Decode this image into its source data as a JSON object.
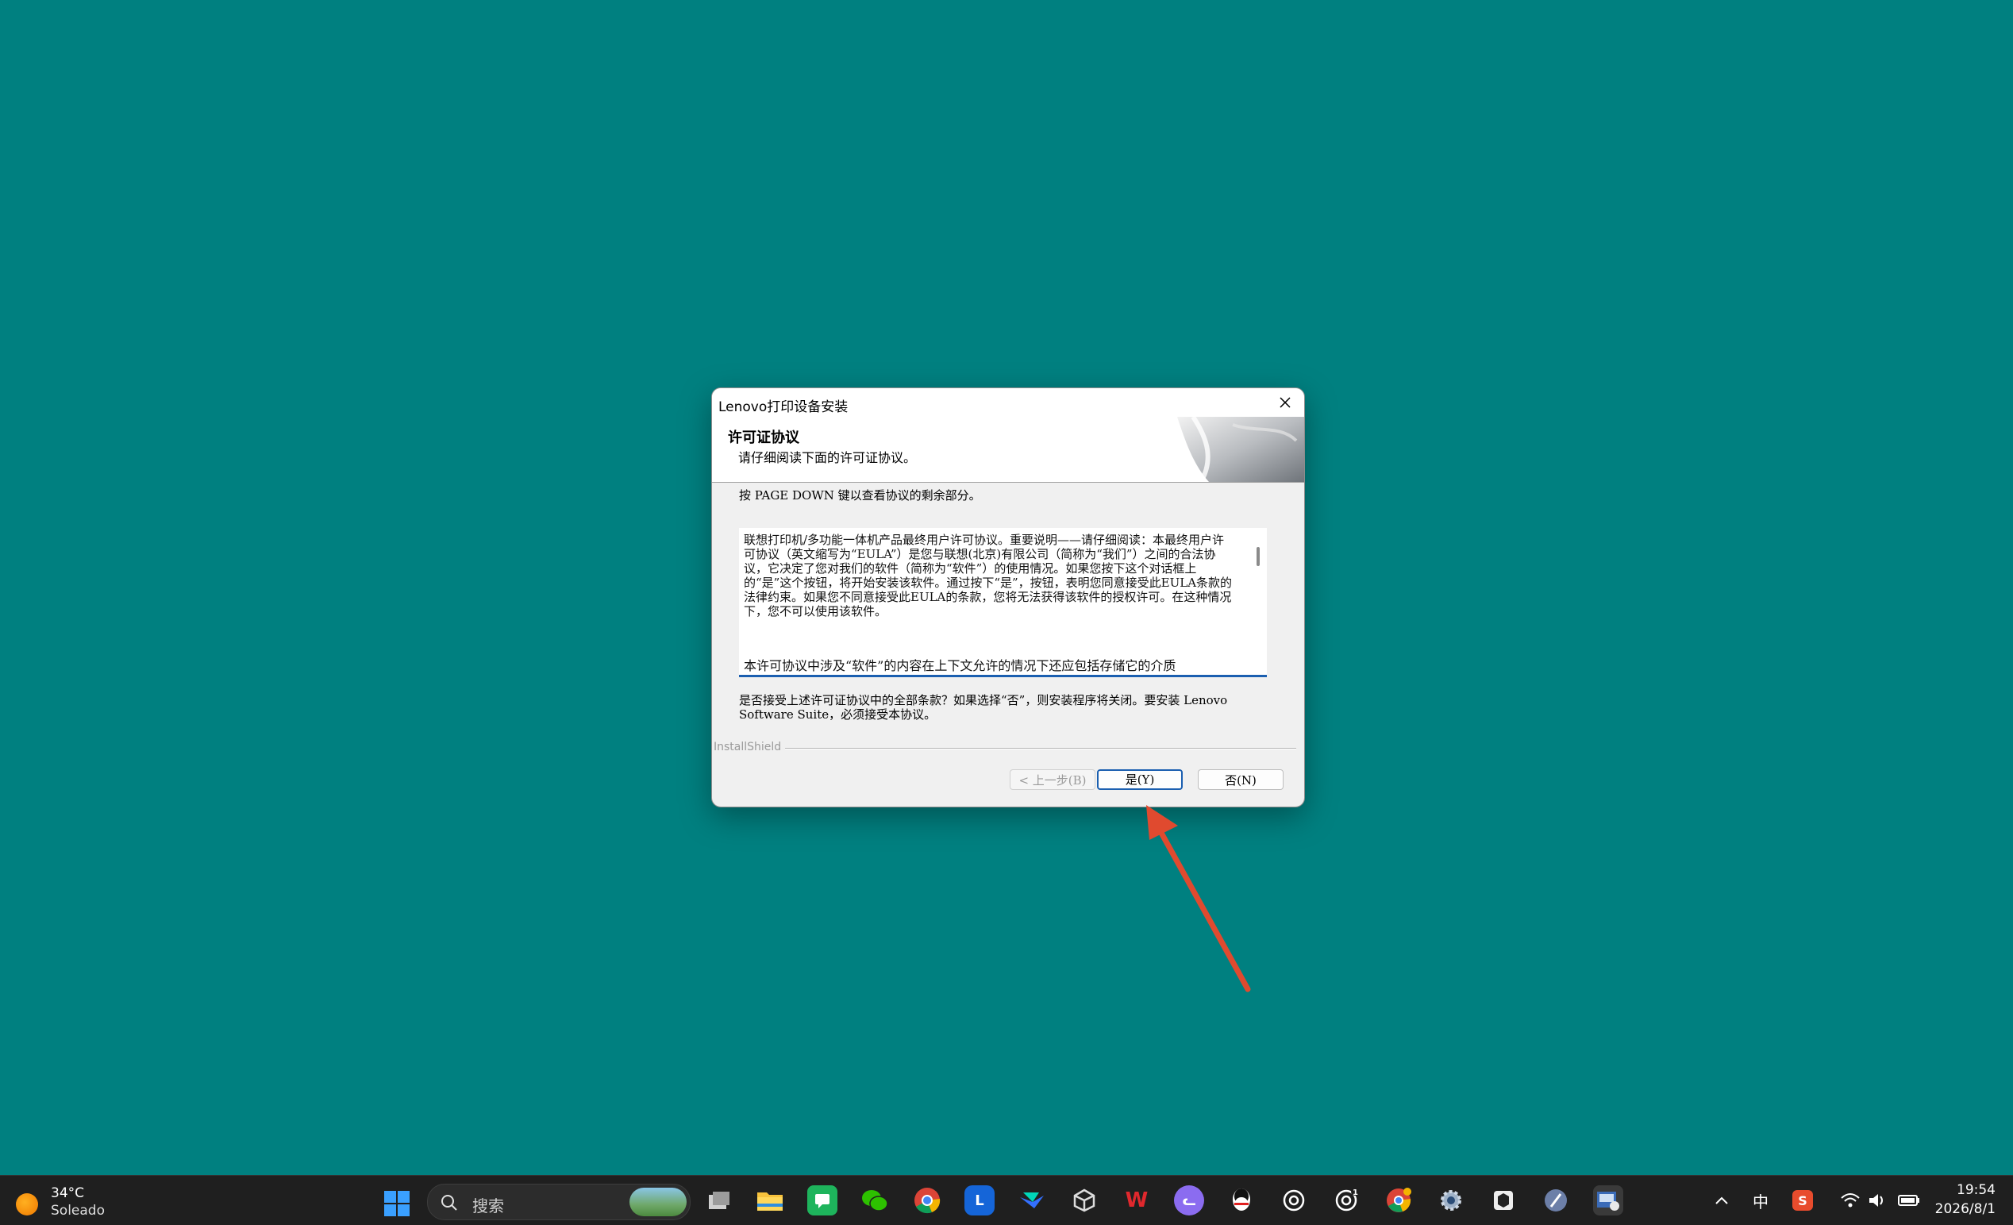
{
  "dialog": {
    "title": "Lenovo打印设备安装",
    "header_title": "许可证协议",
    "header_subtitle": "请仔细阅读下面的许可证协议。",
    "instruction": "按 PAGE DOWN 键以查看协议的剩余部分。",
    "license_paragraph_1": "联想打印机/多功能一体机产品最终用户许可协议。重要说明——请仔细阅读：本最终用户许可协议（英文缩写为“EULA”）是您与联想(北京)有限公司（简称为“我们”）之间的合法协议，它决定了您对我们的软件（简称为“软件”）的使用情况。如果您按下这个对话框上的“是”这个按钮，将开始安装该软件。通过按下“是”，按钮，表明您同意接受此EULA条款的法律约束。如果您不同意接受此EULA的条款，您将无法获得该软件的授权许可。在这种情况下，您不可以使用该软件。",
    "license_paragraph_2": "本许可协议中涉及“软件”的内容在上下文允许的情况下还应包括存储它的介质",
    "question": "是否接受上述许可证协议中的全部条款？如果选择“否”，则安装程序将关闭。要安装 Lenovo Software Suite，必须接受本协议。",
    "installshield_label": "InstallShield",
    "back_button": "< 上一步(B)",
    "yes_button": "是(Y)",
    "no_button": "否(N)"
  },
  "taskbar": {
    "weather_temp": "34°C",
    "weather_condition": "Soleado",
    "search_placeholder": "搜索",
    "ime_label": "中",
    "time": "19:54",
    "date": "2026/8/1"
  },
  "colors": {
    "desktop": "#008080",
    "accent": "#1b5fb0",
    "annotation_arrow": "#e04a2f"
  }
}
